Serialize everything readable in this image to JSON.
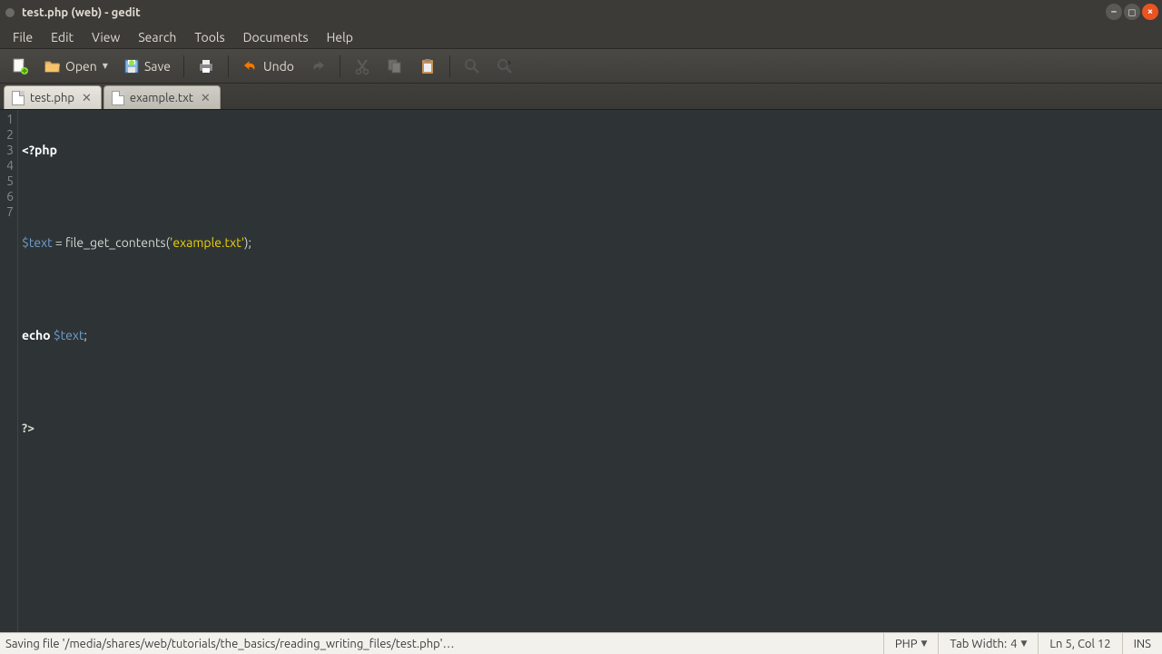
{
  "window": {
    "title": "test.php (web) - gedit"
  },
  "menu": {
    "items": [
      "File",
      "Edit",
      "View",
      "Search",
      "Tools",
      "Documents",
      "Help"
    ]
  },
  "toolbar": {
    "open": "Open",
    "save": "Save",
    "undo": "Undo"
  },
  "tabs": [
    {
      "label": "test.php",
      "active": true
    },
    {
      "label": "example.txt",
      "active": false
    }
  ],
  "code": {
    "line_count": 7,
    "lines": {
      "l1": {
        "open_tag": "<?php"
      },
      "l3": {
        "var": "$text",
        "eq": " = ",
        "fn": "file_get_contents",
        "paren_open": "(",
        "q1": "'",
        "str": "example.txt",
        "q2": "'",
        "close": ");"
      },
      "l5": {
        "kw": "echo",
        "sp": " ",
        "var": "$text",
        "semi": ";"
      },
      "l7": {
        "close_tag": "?>"
      }
    }
  },
  "status": {
    "message": "Saving file '/media/shares/web/tutorials/the_basics/reading_writing_files/test.php'…",
    "language": "PHP",
    "tabwidth_label": "Tab Width:",
    "tabwidth_value": "4",
    "cursor": "Ln 5, Col 12",
    "insert": "INS"
  }
}
